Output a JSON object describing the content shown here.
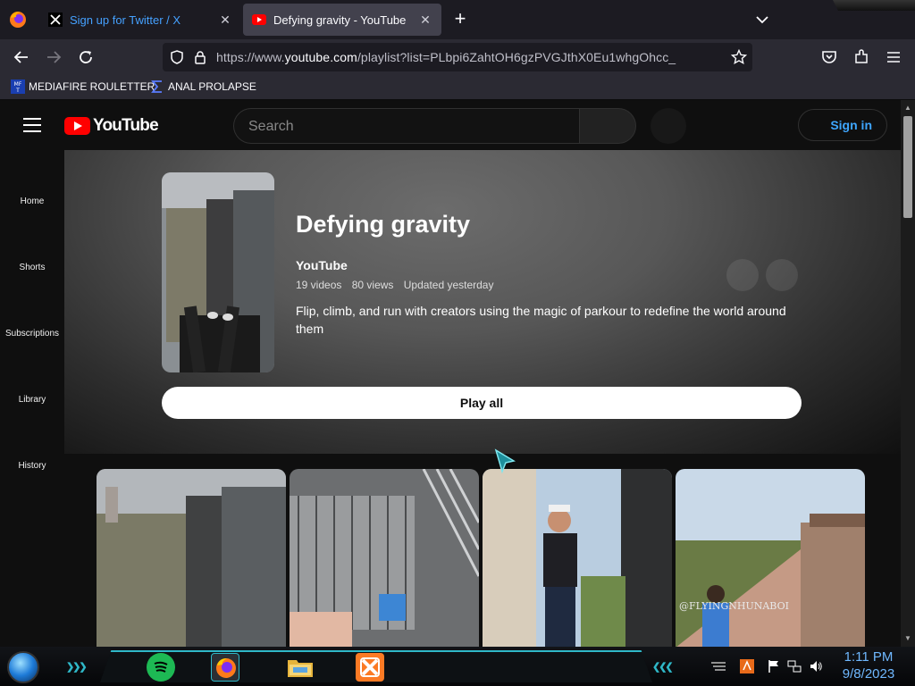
{
  "browser": {
    "tabs": [
      {
        "label": "Sign up for Twitter / X",
        "active": false
      },
      {
        "label": "Defying gravity - YouTube",
        "active": true
      }
    ],
    "url_prefix": "https://www.",
    "url_domain": "youtube.com",
    "url_path": "/playlist?list=PLbpi6ZahtOH6gzPVGJthX0Eu1whgOhcc_",
    "bookmarks": [
      {
        "label": "MEDIAFIRE ROULETTER",
        "icon": "mft-icon"
      },
      {
        "label": "ANAL PROLAPSE",
        "icon": "sigma-icon"
      }
    ]
  },
  "youtube": {
    "logo_text": "YouTube",
    "search_placeholder": "Search",
    "signin_label": "Sign in",
    "guide": [
      "Home",
      "Shorts",
      "Subscriptions",
      "Library",
      "History"
    ],
    "playlist": {
      "title": "Defying gravity",
      "owner": "YouTube",
      "videos": "19 videos",
      "views": "80 views",
      "updated": "Updated yesterday",
      "description": "Flip, climb, and run with creators using the magic of parkour to redefine the world around them",
      "play_all": "Play all"
    },
    "thumbnails": [
      {
        "watermark": ""
      },
      {
        "watermark": ""
      },
      {
        "watermark": ""
      },
      {
        "watermark": "@FLYINGNHUNABOI"
      }
    ]
  },
  "taskbar": {
    "time": "1:11 PM",
    "date": "9/8/2023"
  },
  "colors": {
    "accent_link": "#3ea6ff",
    "yt_red": "#ff0000",
    "taskbar_accent": "#2fb8c8"
  }
}
